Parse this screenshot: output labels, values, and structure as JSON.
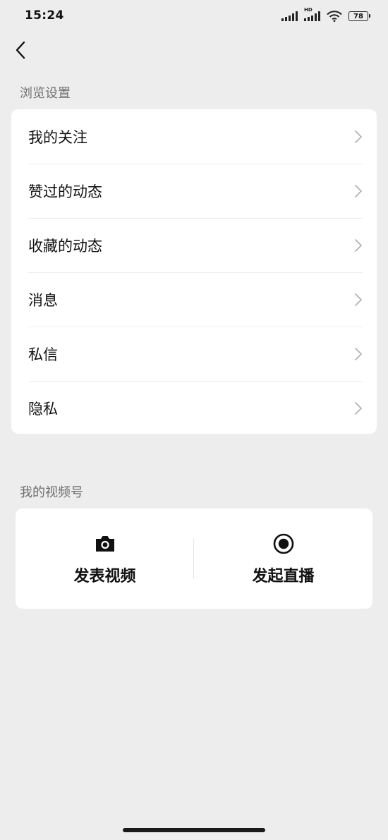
{
  "status_bar": {
    "time": "15:24",
    "hd_label": "HD",
    "battery": "78",
    "icons": [
      "signal-icon",
      "signal-hd-icon",
      "wifi-icon",
      "battery-icon"
    ]
  },
  "nav": {
    "back_icon": "back-arrow-icon"
  },
  "browse_settings": {
    "title": "浏览设置",
    "items": [
      {
        "label": "我的关注"
      },
      {
        "label": "赞过的动态"
      },
      {
        "label": "收藏的动态"
      },
      {
        "label": "消息"
      },
      {
        "label": "私信"
      },
      {
        "label": "隐私"
      }
    ]
  },
  "my_channel": {
    "title": "我的视频号",
    "actions": [
      {
        "label": "发表视频",
        "icon": "camera-icon"
      },
      {
        "label": "发起直播",
        "icon": "live-record-icon"
      }
    ]
  },
  "colors": {
    "background": "#ededed",
    "card": "#ffffff",
    "section_title": "#6f6f6f",
    "chevron": "#b2b2b2"
  }
}
